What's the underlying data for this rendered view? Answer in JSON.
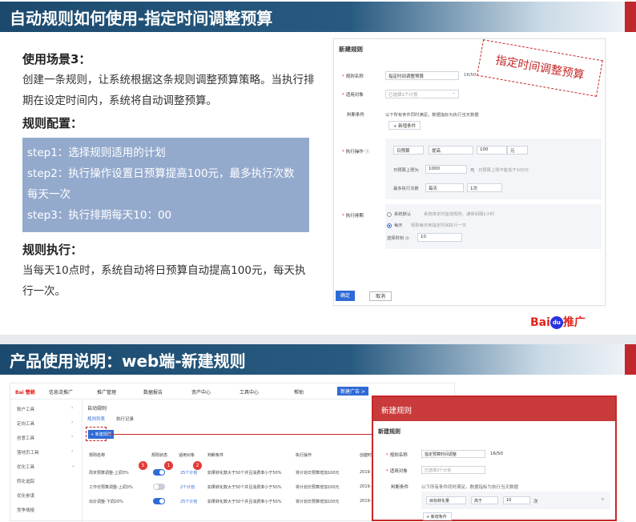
{
  "slide1": {
    "title": "自动规则如何使用-指定时间调整预算",
    "scene_heading": "使用场景3：",
    "scene_text": "创建一条规则，让系统根据这条规则调整预算策略。当执行排期在设定时间内，系统将自动调整预算。",
    "config_heading": "规则配置：",
    "steps": [
      "step1：选择规则适用的计划",
      "step2：执行操作设置日预算提高100元，最多执行次数每天一次",
      "step3：执行排期每天10：00"
    ],
    "exec_heading": "规则执行：",
    "exec_text": "当每天10点时，系统自动将日预算自动提高100元，每天执行一次。",
    "stamp": "指定时间调整预算",
    "logo": {
      "bai": "Bai",
      "du": "du",
      "tuiguang": "推广"
    },
    "panel": {
      "title": "新建规则",
      "rule_name_label": "规则名称",
      "rule_name_value": "指定时间调整预算",
      "rule_name_count": "16/50",
      "target_label": "适用对象",
      "target_value": "已选择1个计划",
      "cond_label": "判断条件",
      "cond_hint": "以下所有条件同时满足。数据指标为执行当天数据",
      "add_cond": "+ 新增条件",
      "action_label": "执行操作",
      "action_field": "日预算",
      "action_op": "提高",
      "action_amount": "100",
      "action_unit": "元",
      "budget_cap_label": "日预算上限为",
      "budget_cap_value": "1000",
      "budget_cap_unit": "元",
      "budget_cap_hint": "日预算上限不能低于100元",
      "max_times_label": "最多执行次数",
      "max_times_period": "每天",
      "max_times_value": "1次",
      "schedule_label": "执行排期",
      "sched_default": "系统默认",
      "sched_default_hint": "系统将定时监测规则，通常间隔1小时",
      "sched_daily": "每天",
      "sched_daily_hint": "规则每天到指定时间执行一次",
      "choose_time_label": "选择时刻",
      "choose_time_value": "10",
      "confirm": "确定",
      "cancel": "取消"
    }
  },
  "slide2": {
    "title": "产品使用说明：web端-新建规则",
    "app": {
      "logo": "Bai 營銷",
      "product": "信息流推广",
      "nav": [
        "推广管理",
        "数据报告",
        "资产中心",
        "工具中心",
        "帮助"
      ],
      "nav_button": "新建广告 >",
      "sidebar": [
        "账户工具",
        "定向工具",
        "创意工具",
        "落地页工具",
        "优化工具",
        "转化追踪",
        "优化参谋",
        "竞争情报"
      ],
      "page_title": "自动规则",
      "tabs": [
        "规则列表",
        "执行记录"
      ],
      "new_rule_btn": "+ 新建规则",
      "columns": [
        "规则名称",
        "规则状态",
        "适用对象",
        "判断条件",
        "执行操作",
        "创建时"
      ],
      "rows": [
        {
          "name": "周末预算调整-上调3%",
          "on": true,
          "target": "25个计划",
          "cond": "如果转化数大于50个并且消费率小于50%",
          "action": "将计划日预算增加100元",
          "date": "2019-"
        },
        {
          "name": "工作日预算调整-上调3%",
          "on": false,
          "target": "2个计划",
          "cond": "如果转化数大于50个并且消费率小于50%",
          "action": "将计划日预算增加100元",
          "date": "2019-"
        },
        {
          "name": "出价调整-下调20%",
          "on": true,
          "target": "25个计划",
          "cond": "如果转化数大于50个并且消费率小于50%",
          "action": "将计划日预算增加100元",
          "date": "2019-"
        }
      ],
      "badges": [
        "5",
        "1",
        "2"
      ]
    },
    "dialog": {
      "header": "新建规则",
      "title": "新建规则",
      "rule_name_label": "规则名称",
      "rule_name_value": "指定预算时间调整",
      "rule_name_count": "16/50",
      "target_label": "适用对象",
      "target_value": "已选择3个计划",
      "cond_label": "判断条件",
      "cond_hint": "以下所有条件同时满足。数据指标为执行当天数据",
      "cond_field": "目标转化量",
      "cond_op": "高于",
      "cond_value": "10",
      "cond_unit": "次",
      "add_cond": "+ 新增条件"
    }
  }
}
